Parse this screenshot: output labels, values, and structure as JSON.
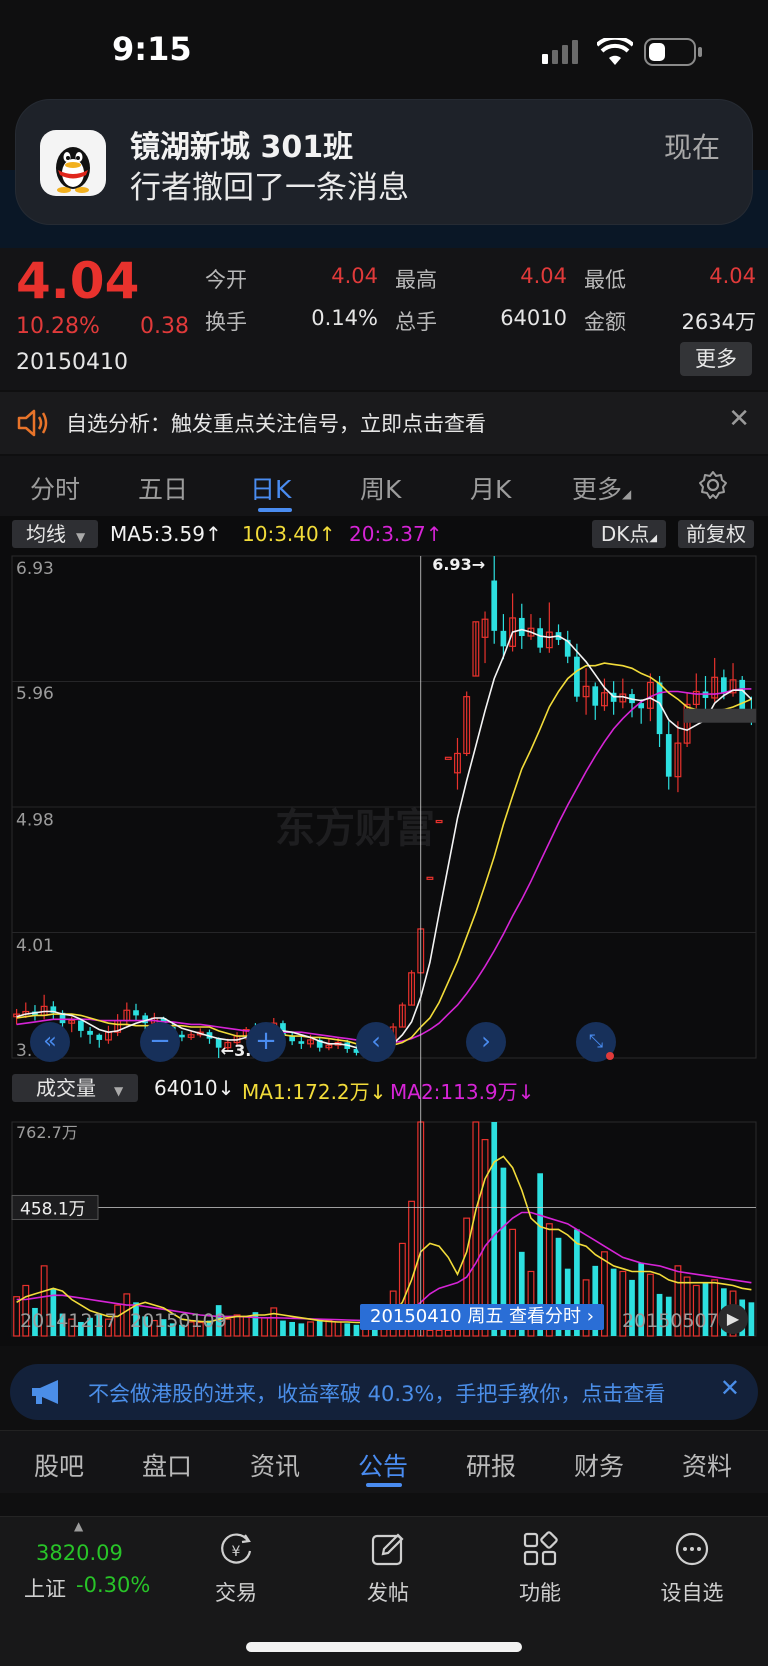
{
  "status_bar": {
    "time": "9:15"
  },
  "notification": {
    "title": "镜湖新城 301班",
    "body": "行者撤回了一条消息",
    "time": "现在",
    "app_icon": "qq-penguin-icon"
  },
  "quote": {
    "price": "4.04",
    "change_pct": "10.28%",
    "change": "0.38",
    "date": "20150410",
    "fields": [
      {
        "label": "今开",
        "value": "4.04",
        "color": "#e03a3a"
      },
      {
        "label": "最高",
        "value": "4.04",
        "color": "#e03a3a"
      },
      {
        "label": "最低",
        "value": "4.04",
        "color": "#e03a3a"
      },
      {
        "label": "换手",
        "value": "0.14%",
        "color": "#e6e6e6"
      },
      {
        "label": "总手",
        "value": "64010",
        "color": "#e6e6e6"
      },
      {
        "label": "金额",
        "value": "2634万",
        "color": "#e6e6e6"
      }
    ],
    "more_label": "更多"
  },
  "alert": {
    "text": "自选分析：触发重点关注信号，立即点击查看"
  },
  "tabs": [
    "分时",
    "五日",
    "日K",
    "周K",
    "月K",
    "更多"
  ],
  "active_tab": 2,
  "kline": {
    "indicator_label": "均线",
    "ma5": "MA5:3.59",
    "ma10": "10:3.40",
    "ma20": "20:3.37",
    "dk_label": "DK点",
    "adjust_label": "前复权",
    "price_ticks": [
      "6.93",
      "5.96",
      "4.98",
      "4.01",
      "3.04"
    ],
    "high_marker": "6.93",
    "low_marker": "3.04",
    "watermark": "东方财富"
  },
  "volume": {
    "indicator_label": "成交量",
    "vol": "64010",
    "ma1": "MA1:172.2万",
    "ma2": "MA2:113.9万",
    "max_tick": "762.7万",
    "cursor_tick": "458.1万"
  },
  "dates": {
    "d1": "20141217",
    "d2": "20150109",
    "cursor": "20150410 周五 查看分时",
    "d4": "20150507"
  },
  "banner": {
    "text": "不会做港股的进来，收益率破 40.3%，手把手教你，点击查看"
  },
  "bottom_tabs": [
    "股吧",
    "盘口",
    "资讯",
    "公告",
    "研报",
    "财务",
    "资料"
  ],
  "active_bottom_tab": 3,
  "footer": {
    "index_value": "3820.09",
    "index_name": "上证",
    "index_change": "-0.30%",
    "items": [
      "交易",
      "发帖",
      "功能",
      "设自选"
    ]
  },
  "chart_data": {
    "type": "candlestick",
    "price_range": [
      3.04,
      6.93
    ],
    "volume_range": [
      0,
      762.7
    ],
    "candles": [
      [
        3.36,
        3.38,
        3.42,
        3.3
      ],
      [
        3.38,
        3.4,
        3.47,
        3.35
      ],
      [
        3.4,
        3.37,
        3.45,
        3.33
      ],
      [
        3.37,
        3.44,
        3.53,
        3.34
      ],
      [
        3.44,
        3.39,
        3.48,
        3.34
      ],
      [
        3.39,
        3.31,
        3.41,
        3.27
      ],
      [
        3.31,
        3.33,
        3.36,
        3.24
      ],
      [
        3.33,
        3.25,
        3.34,
        3.2
      ],
      [
        3.25,
        3.22,
        3.28,
        3.15
      ],
      [
        3.22,
        3.18,
        3.23,
        3.12
      ],
      [
        3.18,
        3.24,
        3.29,
        3.15
      ],
      [
        3.24,
        3.33,
        3.38,
        3.21
      ],
      [
        3.33,
        3.41,
        3.47,
        3.29
      ],
      [
        3.41,
        3.37,
        3.46,
        3.33
      ],
      [
        3.37,
        3.31,
        3.39,
        3.26
      ],
      [
        3.31,
        3.35,
        3.39,
        3.27
      ],
      [
        3.35,
        3.28,
        3.36,
        3.22
      ],
      [
        3.28,
        3.22,
        3.31,
        3.19
      ],
      [
        3.22,
        3.2,
        3.25,
        3.17
      ],
      [
        3.2,
        3.22,
        3.25,
        3.18
      ],
      [
        3.22,
        3.24,
        3.27,
        3.2
      ],
      [
        3.24,
        3.19,
        3.26,
        3.15
      ],
      [
        3.19,
        3.12,
        3.2,
        3.04
      ],
      [
        3.12,
        3.16,
        3.19,
        3.09
      ],
      [
        3.16,
        3.21,
        3.24,
        3.13
      ],
      [
        3.21,
        3.26,
        3.28,
        3.18
      ],
      [
        3.26,
        3.23,
        3.31,
        3.2
      ],
      [
        3.23,
        3.26,
        3.29,
        3.2
      ],
      [
        3.26,
        3.31,
        3.35,
        3.22
      ],
      [
        3.31,
        3.21,
        3.33,
        3.18
      ],
      [
        3.21,
        3.17,
        3.24,
        3.14
      ],
      [
        3.17,
        3.15,
        3.21,
        3.11
      ],
      [
        3.15,
        3.18,
        3.22,
        3.12
      ],
      [
        3.18,
        3.12,
        3.2,
        3.09
      ],
      [
        3.12,
        3.14,
        3.19,
        3.1
      ],
      [
        3.14,
        3.16,
        3.2,
        3.11
      ],
      [
        3.16,
        3.11,
        3.18,
        3.08
      ],
      [
        3.11,
        3.08,
        3.14,
        3.06
      ],
      [
        3.08,
        3.12,
        3.14,
        3.06
      ],
      [
        3.12,
        3.1,
        3.13,
        3.07
      ],
      [
        3.1,
        3.15,
        3.2,
        3.09
      ],
      [
        3.15,
        3.28,
        3.31,
        3.15
      ],
      [
        3.28,
        3.45,
        3.47,
        3.28
      ],
      [
        3.45,
        3.7,
        3.72,
        3.45
      ],
      [
        3.7,
        4.04,
        4.04,
        4.04
      ],
      [
        4.44,
        4.44,
        4.44,
        4.44
      ],
      [
        4.88,
        4.88,
        4.88,
        4.88
      ],
      [
        5.37,
        5.37,
        5.37,
        5.37
      ],
      [
        5.25,
        5.4,
        5.52,
        5.12
      ],
      [
        5.4,
        5.84,
        5.88,
        5.38
      ],
      [
        6.0,
        6.42,
        6.42,
        6.0
      ],
      [
        6.3,
        6.44,
        6.5,
        6.1
      ],
      [
        6.74,
        6.35,
        6.93,
        6.25
      ],
      [
        6.35,
        6.23,
        6.48,
        6.13
      ],
      [
        6.23,
        6.45,
        6.64,
        6.19
      ],
      [
        6.45,
        6.31,
        6.56,
        6.21
      ],
      [
        6.31,
        6.37,
        6.48,
        6.28
      ],
      [
        6.37,
        6.22,
        6.45,
        6.18
      ],
      [
        6.22,
        6.34,
        6.57,
        6.18
      ],
      [
        6.34,
        6.28,
        6.4,
        6.24
      ],
      [
        6.28,
        6.15,
        6.35,
        6.1
      ],
      [
        6.15,
        5.84,
        6.25,
        5.8
      ],
      [
        5.84,
        5.92,
        6.06,
        5.7
      ],
      [
        5.92,
        5.77,
        5.95,
        5.66
      ],
      [
        5.77,
        5.87,
        5.98,
        5.73
      ],
      [
        5.87,
        5.8,
        5.96,
        5.7
      ],
      [
        5.8,
        5.86,
        5.98,
        5.75
      ],
      [
        5.86,
        5.79,
        5.9,
        5.68
      ],
      [
        5.79,
        5.75,
        5.82,
        5.63
      ],
      [
        5.75,
        5.95,
        6.02,
        5.65
      ],
      [
        5.95,
        5.55,
        6.0,
        5.45
      ],
      [
        5.55,
        5.22,
        5.65,
        5.12
      ],
      [
        5.22,
        5.48,
        5.65,
        5.1
      ],
      [
        5.48,
        5.78,
        5.87,
        5.45
      ],
      [
        5.78,
        5.88,
        6.02,
        5.75
      ],
      [
        5.88,
        5.83,
        6.0,
        5.7
      ],
      [
        5.83,
        5.99,
        6.14,
        5.8
      ],
      [
        5.99,
        5.87,
        6.05,
        5.82
      ],
      [
        5.87,
        5.97,
        6.1,
        5.84
      ],
      [
        5.97,
        5.74,
        6.0,
        5.68
      ],
      [
        5.74,
        5.69,
        5.84,
        5.62
      ]
    ],
    "volume": [
      140,
      180,
      100,
      250,
      170,
      80,
      60,
      50,
      65,
      80,
      60,
      110,
      150,
      120,
      70,
      55,
      60,
      45,
      40,
      50,
      48,
      55,
      110,
      60,
      75,
      70,
      85,
      65,
      100,
      55,
      50,
      45,
      50,
      60,
      55,
      50,
      45,
      40,
      50,
      55,
      70,
      160,
      330,
      480,
      762.7,
      20,
      20,
      20,
      25,
      420,
      762.7,
      700,
      762.7,
      600,
      380,
      300,
      230,
      580,
      400,
      350,
      240,
      380,
      200,
      250,
      300,
      240,
      230,
      200,
      260,
      220,
      150,
      140,
      250,
      210,
      180,
      190,
      200,
      170,
      160,
      130,
      120
    ],
    "ma5": [
      3.36,
      3.38,
      3.39,
      3.4,
      3.4,
      3.38,
      3.37,
      3.34,
      3.3,
      3.26,
      3.24,
      3.25,
      3.28,
      3.31,
      3.33,
      3.35,
      3.35,
      3.31,
      3.27,
      3.25,
      3.23,
      3.21,
      3.19,
      3.18,
      3.18,
      3.2,
      3.22,
      3.24,
      3.26,
      3.25,
      3.24,
      3.22,
      3.2,
      3.17,
      3.15,
      3.15,
      3.14,
      3.12,
      3.12,
      3.11,
      3.11,
      3.15,
      3.22,
      3.32,
      3.51,
      3.78,
      4.16,
      4.53,
      4.9,
      5.19,
      5.46,
      5.73,
      5.98,
      6.15,
      6.34,
      6.36,
      6.34,
      6.31,
      6.3,
      6.31,
      6.27,
      6.19,
      6.11,
      6.01,
      5.91,
      5.84,
      5.84,
      5.82,
      5.81,
      5.83,
      5.79,
      5.66,
      5.6,
      5.58,
      5.62,
      5.66,
      5.79,
      5.85,
      5.89,
      5.89,
      5.82
    ],
    "ma10": [
      3.35,
      3.36,
      3.37,
      3.37,
      3.38,
      3.38,
      3.38,
      3.37,
      3.35,
      3.33,
      3.31,
      3.3,
      3.3,
      3.29,
      3.29,
      3.29,
      3.29,
      3.29,
      3.29,
      3.28,
      3.28,
      3.28,
      3.25,
      3.23,
      3.21,
      3.21,
      3.21,
      3.21,
      3.22,
      3.22,
      3.21,
      3.21,
      3.2,
      3.2,
      3.19,
      3.18,
      3.17,
      3.15,
      3.14,
      3.13,
      3.13,
      3.14,
      3.16,
      3.2,
      3.28,
      3.35,
      3.47,
      3.63,
      3.79,
      3.98,
      4.17,
      4.38,
      4.6,
      4.85,
      5.07,
      5.28,
      5.43,
      5.59,
      5.76,
      5.88,
      5.98,
      6.04,
      6.08,
      6.08,
      6.1,
      6.09,
      6.08,
      6.06,
      6.02,
      5.99,
      5.94,
      5.87,
      5.82,
      5.76,
      5.74,
      5.73,
      5.73,
      5.74,
      5.76,
      5.79,
      5.82
    ],
    "ma20": [
      3.3,
      3.31,
      3.32,
      3.33,
      3.34,
      3.34,
      3.34,
      3.34,
      3.34,
      3.33,
      3.33,
      3.33,
      3.33,
      3.33,
      3.33,
      3.33,
      3.32,
      3.32,
      3.31,
      3.3,
      3.3,
      3.29,
      3.28,
      3.27,
      3.26,
      3.25,
      3.25,
      3.25,
      3.25,
      3.24,
      3.24,
      3.24,
      3.23,
      3.22,
      3.21,
      3.2,
      3.19,
      3.18,
      3.17,
      3.16,
      3.16,
      3.16,
      3.17,
      3.19,
      3.22,
      3.26,
      3.31,
      3.38,
      3.45,
      3.54,
      3.64,
      3.75,
      3.87,
      4.0,
      4.14,
      4.27,
      4.41,
      4.56,
      4.71,
      4.86,
      5.0,
      5.13,
      5.26,
      5.38,
      5.49,
      5.59,
      5.67,
      5.74,
      5.8,
      5.84,
      5.87,
      5.88,
      5.88,
      5.87,
      5.86,
      5.86,
      5.86,
      5.87,
      5.89,
      5.9,
      5.9
    ],
    "vol_ma1": [
      120,
      140,
      150,
      160,
      170,
      160,
      130,
      110,
      90,
      80,
      70,
      70,
      90,
      110,
      120,
      110,
      100,
      80,
      60,
      55,
      52,
      50,
      60,
      65,
      70,
      70,
      75,
      75,
      80,
      75,
      70,
      65,
      60,
      55,
      52,
      50,
      50,
      48,
      48,
      50,
      55,
      80,
      120,
      200,
      300,
      330,
      320,
      280,
      220,
      300,
      450,
      560,
      620,
      640,
      600,
      520,
      420,
      390,
      380,
      380,
      360,
      330,
      320,
      290,
      270,
      250,
      240,
      230,
      230,
      230,
      220,
      200,
      190,
      190,
      190,
      190,
      190,
      185,
      180,
      170,
      165
    ],
    "vol_ma2": [
      130,
      130,
      135,
      140,
      145,
      145,
      140,
      135,
      130,
      125,
      120,
      115,
      110,
      110,
      105,
      100,
      95,
      90,
      85,
      80,
      75,
      72,
      70,
      70,
      70,
      68,
      66,
      65,
      65,
      64,
      63,
      62,
      61,
      60,
      59,
      58,
      57,
      56,
      55,
      55,
      56,
      60,
      70,
      90,
      120,
      150,
      170,
      180,
      190,
      210,
      260,
      320,
      360,
      390,
      420,
      440,
      440,
      430,
      420,
      410,
      400,
      380,
      360,
      340,
      320,
      300,
      280,
      270,
      260,
      255,
      250,
      240,
      230,
      225,
      220,
      215,
      210,
      205,
      200,
      195,
      190
    ]
  }
}
